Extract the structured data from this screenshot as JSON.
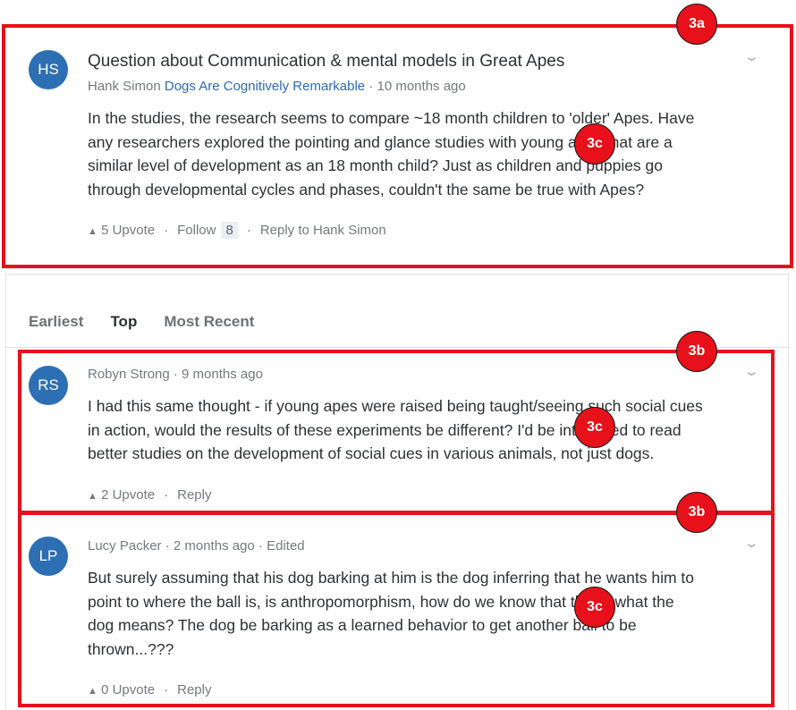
{
  "question": {
    "avatar_initials": "HS",
    "title": "Question about Communication & mental models in Great Apes",
    "author": "Hank Simon",
    "category": "Dogs Are Cognitively Remarkable",
    "time": "· 10 months ago",
    "body_lines": [
      "In the studies, the research seems to compare ~18 month children to 'older' Apes. Have",
      "any researchers explored the pointing and glance studies with young apes that are a",
      "similar level of development as an 18 month child? Just as children and puppies go",
      "through developmental cycles and phases, couldn't the same be true with Apes?"
    ],
    "upvote_label": "5 Upvote",
    "follow_label": "Follow",
    "follow_count": "8",
    "reply_label": "Reply to Hank Simon"
  },
  "sort_tabs": {
    "earliest": "Earliest",
    "top": "Top",
    "most_recent": "Most Recent",
    "active": "Top"
  },
  "comments": [
    {
      "avatar_initials": "RS",
      "meta": "Robyn Strong · 9 months ago",
      "body_lines": [
        "I had this same thought - if young apes were raised being taught/seeing such social cues",
        "in action, would the results of these experiments be different? I'd be interested to read",
        "better studies on the development of social cues in various animals, not just dogs."
      ],
      "upvote_label": "2 Upvote",
      "reply_label": "Reply"
    },
    {
      "avatar_initials": "LP",
      "meta": "Lucy Packer · 2 months ago · Edited",
      "body_lines": [
        "But surely assuming that his dog barking at him is the dog inferring that he wants him to",
        "point to where the ball is, is anthropomorphism, how do we know that this is what the",
        "dog means? The dog be barking as a learned behavior to get another ball to be",
        "thrown...???"
      ],
      "upvote_label": "0 Upvote",
      "reply_label": "Reply"
    }
  ],
  "annotations": {
    "question_box": "3a",
    "comment_box": "3b",
    "content_marker": "3c"
  },
  "colors": {
    "annotation_red": "#e8101a",
    "avatar_blue": "#2d6fb3",
    "link_blue": "#2f69b3"
  },
  "icons": {
    "upvote": "triangle-up-icon",
    "menu": "chevron-down-icon"
  }
}
